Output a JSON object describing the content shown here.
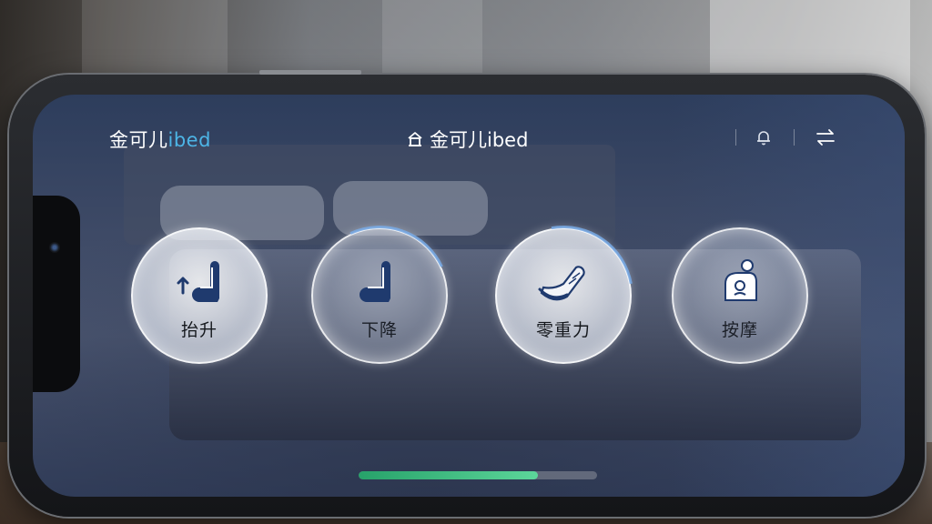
{
  "header": {
    "brand_prefix": "金可儿",
    "brand_suffix": "ibed",
    "center_title": "金可儿ibed",
    "bell_icon": "bell-icon",
    "switch_icon": "switch-arrows-icon"
  },
  "controls": [
    {
      "label": "抬升",
      "icon": "seat-raise-icon"
    },
    {
      "label": "下降",
      "icon": "seat-lower-icon"
    },
    {
      "label": "零重力",
      "icon": "zero-gravity-icon"
    },
    {
      "label": "按摩",
      "icon": "massage-icon"
    }
  ],
  "progress": {
    "value": 0.75
  },
  "colors": {
    "accent": "#4db5e6",
    "progress": "#3fbf7f",
    "icon_navy": "#1f3a6e"
  }
}
